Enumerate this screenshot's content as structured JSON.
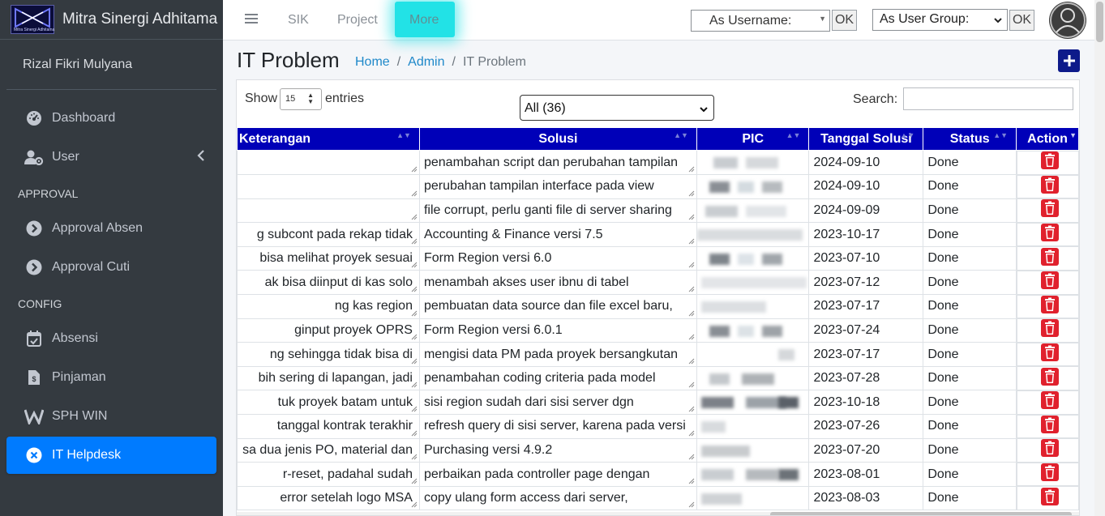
{
  "brand": {
    "name": "Mitra Sinergi Adhitama",
    "logo_text": "Mitra Sinergi Adhitama"
  },
  "user": {
    "name": "Rizal Fikri Mulyana"
  },
  "sidebar": {
    "items": [
      {
        "label": "Dashboard",
        "icon": "dashboard-gauge-icon"
      },
      {
        "label": "User",
        "icon": "user-gear-icon"
      }
    ],
    "approval_header": "APPROVAL",
    "approval_items": [
      {
        "label": "Approval Absen"
      },
      {
        "label": "Approval Cuti"
      }
    ],
    "config_header": "CONFIG",
    "config_items": [
      {
        "label": "Absensi",
        "icon": "calendar-check-icon"
      },
      {
        "label": "Pinjaman",
        "icon": "file-invoice-dollar-icon"
      },
      {
        "label": "SPH WIN",
        "icon": "w-letter-icon"
      }
    ],
    "active_item": {
      "label": "IT Helpdesk",
      "icon": "close-circle-icon"
    },
    "active_color": "#007bff",
    "bg_color": "#343a40"
  },
  "topbar": {
    "links": [
      "SIK",
      "Project",
      "More"
    ],
    "as_username_label": "As Username:",
    "ok_label": "OK",
    "as_group_label": "As User Group:",
    "highlight_color": "#22e2e6"
  },
  "page": {
    "title": "IT Problem",
    "breadcrumb": [
      "Home",
      "Admin",
      "IT Problem"
    ]
  },
  "table_controls": {
    "show_label": "Show",
    "show_value": "15",
    "entries_label": "entries",
    "filter_value": "All (36)",
    "search_label": "Search:"
  },
  "table": {
    "header_color": "#0000b8",
    "columns": [
      "Keterangan",
      "Solusi",
      "PIC",
      "Tanggal Solusi",
      "Status",
      "Action"
    ],
    "rows": [
      {
        "keterangan": "",
        "solusi": "penambahan script dan perubahan tampilan",
        "tanggal": "2024-09-10",
        "status": "Done"
      },
      {
        "keterangan": "",
        "solusi": "perubahan tampilan interface pada view",
        "tanggal": "2024-09-10",
        "status": "Done"
      },
      {
        "keterangan": "",
        "solusi": "file corrupt, perlu ganti file di server sharing",
        "tanggal": "2024-09-09",
        "status": "Done"
      },
      {
        "keterangan": "g subcont pada rekap tidak",
        "solusi": "Accounting & Finance versi 7.5",
        "tanggal": "2023-10-17",
        "status": "Done"
      },
      {
        "keterangan": "bisa melihat proyek sesuai",
        "solusi": "Form Region versi 6.0",
        "tanggal": "2023-07-10",
        "status": "Done"
      },
      {
        "keterangan": "ak bisa diinput di kas solo",
        "solusi": "menambah akses user ibnu di tabel",
        "tanggal": "2023-07-12",
        "status": "Done"
      },
      {
        "keterangan": "ng kas region",
        "solusi": "pembuatan data source dan file excel baru,",
        "tanggal": "2023-07-17",
        "status": "Done"
      },
      {
        "keterangan": "ginput proyek OPRS",
        "solusi": "Form Region versi 6.0.1",
        "tanggal": "2023-07-24",
        "status": "Done"
      },
      {
        "keterangan": "ng sehingga tidak bisa di",
        "solusi": "mengisi data PM pada proyek bersangkutan",
        "tanggal": "2023-07-17",
        "status": "Done"
      },
      {
        "keterangan": "bih sering di lapangan, jadi",
        "solusi": "penambahan coding criteria pada model",
        "tanggal": "2023-07-28",
        "status": "Done"
      },
      {
        "keterangan": "tuk proyek batam untuk",
        "solusi": "sisi region sudah dari sisi server dgn",
        "tanggal": "2023-10-18",
        "status": "Done"
      },
      {
        "keterangan": "tanggal kontrak terakhir",
        "solusi": "refresh query di sisi server, karena pada versi",
        "tanggal": "2023-07-26",
        "status": "Done"
      },
      {
        "keterangan": "sa dua jenis PO, material dan",
        "solusi": "Purchasing versi 4.9.2",
        "tanggal": "2023-07-20",
        "status": "Done"
      },
      {
        "keterangan": "r-reset, padahal sudah",
        "solusi": "perbaikan pada controller page dengan",
        "tanggal": "2023-08-01",
        "status": "Done"
      },
      {
        "keterangan": "error setelah logo MSA",
        "solusi": "copy ulang form access dari server,",
        "tanggal": "2023-08-03",
        "status": "Done"
      }
    ],
    "delete_color": "#e0212d"
  }
}
